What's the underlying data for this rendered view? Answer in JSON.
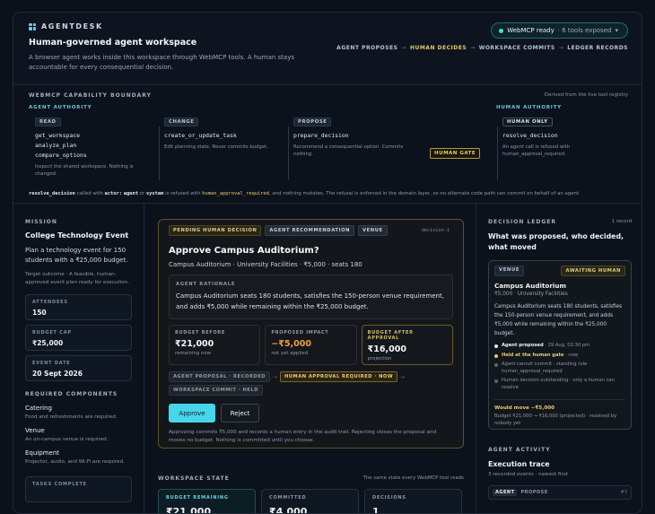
{
  "brand": {
    "name": "AGENTDESK"
  },
  "header": {
    "title": "Human-governed agent workspace",
    "subtitle": "A browser agent works inside this workspace through WebMCP tools. A human stays accountable for every consequential decision.",
    "status": {
      "label": "WebMCP ready",
      "detail": "· 6 tools exposed",
      "dot_color": "#3fe0d0"
    },
    "flow": [
      "AGENT PROPOSES",
      "HUMAN DECIDES",
      "WORKSPACE COMMITS",
      "LEDGER RECORDS"
    ],
    "flow_separator": "→"
  },
  "capability": {
    "heading": "WEBMCP CAPABILITY BOUNDARY",
    "derived": "Derived from the live tool registry",
    "agent_authority": "AGENT AUTHORITY",
    "human_authority": "HUMAN AUTHORITY",
    "groups": [
      {
        "tag": "READ",
        "tools": [
          "get_workspace",
          "analyze_plan",
          "compare_options"
        ],
        "desc": "Inspect the shared workspace. Nothing is changed."
      },
      {
        "tag": "CHANGE",
        "tools": [
          "create_or_update_task"
        ],
        "desc": "Edit planning state. Never commits budget."
      },
      {
        "tag": "PROPOSE",
        "tools": [
          "prepare_decision"
        ],
        "desc": "Recommend a consequential option. Commits nothing."
      },
      {
        "tag": "HUMAN ONLY",
        "tools": [
          "resolve_decision"
        ],
        "desc": "An agent call is refused with human_approval_required."
      }
    ],
    "gate": "HUMAN GATE",
    "rule": {
      "tool": "resolve_decision",
      "t1": " called with ",
      "actor": "actor:",
      "t2": " ",
      "agent": "agent",
      "t3": " or ",
      "system": "system",
      "t4": " is refused with ",
      "code": "human_approval_required",
      "t5": ", and nothing mutates. The refusal is enforced in the domain layer, so no alternate code path can commit on behalf of an agent."
    }
  },
  "mission": {
    "heading": "MISSION",
    "title": "College Technology Event",
    "desc": "Plan a technology event for 150 students with a ₹25,000 budget.",
    "target": "Target outcome · A feasible, human-approved event plan ready for execution.",
    "stats": [
      {
        "label": "ATTENDEES",
        "value": "150"
      },
      {
        "label": "BUDGET CAP",
        "value": "₹25,000"
      },
      {
        "label": "EVENT DATE",
        "value": "20 Sept 2026"
      }
    ],
    "req_heading": "REQUIRED COMPONENTS",
    "components": [
      {
        "name": "Catering",
        "desc": "Food and refreshments are required."
      },
      {
        "name": "Venue",
        "desc": "An on-campus venue is required."
      },
      {
        "name": "Equipment",
        "desc": "Projector, audio, and Wi-Fi are required."
      }
    ],
    "tasks_heading": "TASKS COMPLETE"
  },
  "decision": {
    "chips": [
      "PENDING HUMAN DECISION",
      "AGENT RECOMMENDATION",
      "VENUE"
    ],
    "id": "decision-1",
    "title": "Approve Campus Auditorium?",
    "subtitle": "Campus Auditorium · University Facilities · ₹5,000 · seats 180",
    "rationale_label": "AGENT RATIONALE",
    "rationale": "Campus Auditorium seats 180 students, satisfies the 150-person venue requirement, and adds ₹5,000 while remaining within the ₹25,000 budget.",
    "metrics": [
      {
        "label": "BUDGET BEFORE",
        "value": "₹21,000",
        "sub": "remaining now"
      },
      {
        "label": "PROPOSED IMPACT",
        "value": "−₹5,000",
        "sub": "not yet applied"
      },
      {
        "label": "BUDGET AFTER APPROVAL",
        "value": "₹16,000",
        "sub": "projection"
      }
    ],
    "steps": [
      "AGENT PROPOSAL · RECORDED",
      "HUMAN APPROVAL REQUIRED · NOW",
      "WORKSPACE COMMIT · HELD"
    ],
    "approve": "Approve",
    "reject": "Reject",
    "footer": "Approving commits ₹5,000 and records a human entry in the audit trail. Rejecting closes the proposal and moves no budget. Nothing is committed until you choose."
  },
  "workspace": {
    "heading": "WORKSPACE STATE",
    "note": "The same state every WebMCP tool reads",
    "tiles": [
      {
        "label": "BUDGET REMAINING",
        "value": "₹21,000"
      },
      {
        "label": "COMMITTED",
        "value": "₹4,000"
      },
      {
        "label": "DECISIONS",
        "value": "1"
      }
    ]
  },
  "ledger": {
    "heading": "DECISION LEDGER",
    "count": "1 record",
    "title": "What was proposed, who decided, what moved",
    "card": {
      "tag": "VENUE",
      "status": "AWAITING HUMAN",
      "title": "Campus Auditorium",
      "sub": "₹5,000 · University Facilities",
      "desc": "Campus Auditorium seats 180 students, satisfies the 150-person venue requirement, and adds ₹5,000 while remaining within the ₹25,000 budget.",
      "timeline": [
        {
          "bold": "Agent proposed",
          "rest": " · 29 Aug, 02:30 pm"
        },
        {
          "bold": "Held at the human gate",
          "rest": " · now"
        },
        {
          "bold": "",
          "rest": "Agent cannot commit · standing rule · human_approval_required"
        },
        {
          "bold": "",
          "rest": "Human decision outstanding · only a human can resolve"
        }
      ],
      "would_move": "Would move −₹5,000",
      "would_detail": "Budget ₹21,000 → ₹16,000 (projected) · resolved by nobody yet"
    }
  },
  "activity": {
    "heading": "AGENT ACTIVITY",
    "title": "Execution trace",
    "sub": "3 recorded events · newest first",
    "first_event": {
      "actor": "AGENT",
      "kind": "PROPOSE",
      "num": "#3"
    }
  }
}
